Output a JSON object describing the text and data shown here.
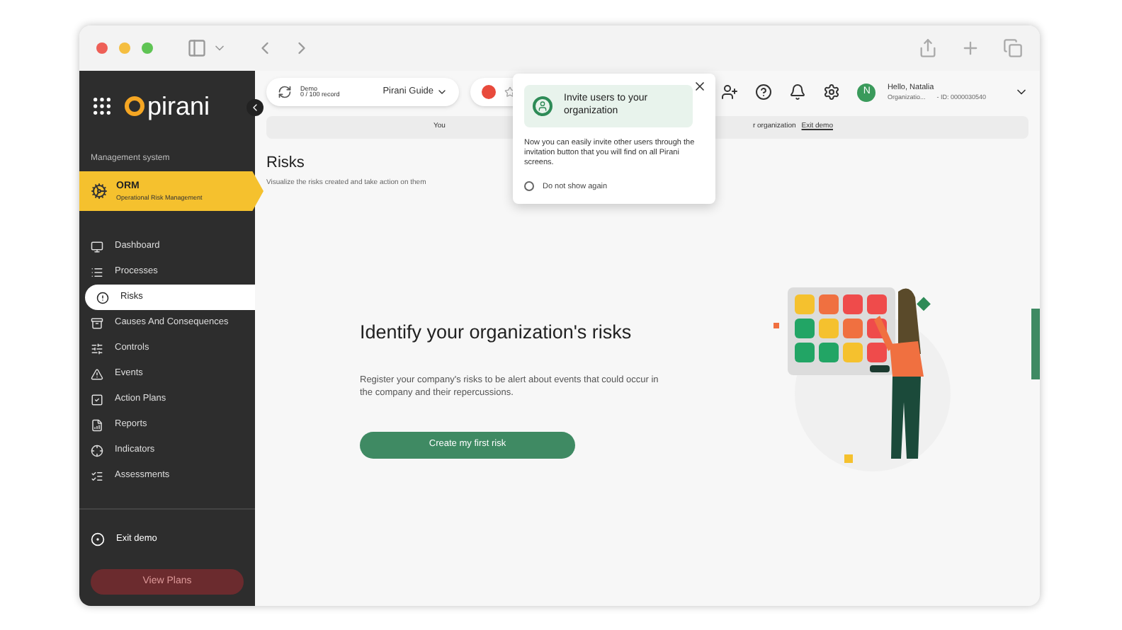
{
  "topbar": {
    "plan_title": "Demo",
    "plan_usage": "0 / 100 record",
    "guide": "Pirani Guide",
    "user_greeting": "Hello, Natalia",
    "organization": "Organizatio...",
    "org_id": "- ID: 0000030540",
    "avatar_initial": "N"
  },
  "banner": {
    "text_start": "You",
    "text_end": "r organization",
    "link": "Exit demo"
  },
  "popover": {
    "title": "Invite users to your organization",
    "body": "Now you can easily invite other users through the invitation button that you will find on all Pirani screens.",
    "checkbox": {
      "label": "Do not show again",
      "checked": false
    }
  },
  "sidebar": {
    "section": "Management system",
    "module": {
      "title": "ORM",
      "subtitle": "Operational Risk Management"
    },
    "logo": "pirani",
    "items": [
      {
        "label": "Dashboard",
        "selected": false
      },
      {
        "label": "Processes",
        "selected": false
      },
      {
        "label": "Risks",
        "selected": true
      },
      {
        "label": "Causes And Consequences",
        "selected": false
      },
      {
        "label": "Controls",
        "selected": false
      },
      {
        "label": "Events",
        "selected": false
      },
      {
        "label": "Action Plans",
        "selected": false
      },
      {
        "label": "Reports",
        "selected": false
      },
      {
        "label": "Indicators",
        "selected": false
      },
      {
        "label": "Assessments",
        "selected": false
      }
    ],
    "exit": "Exit demo",
    "plans_button": "View Plans"
  },
  "page": {
    "title": "Risks",
    "subtitle": "Visualize the risks created and take action on them"
  },
  "empty_state": {
    "heading": "Identify your organization's risks",
    "text": "Register your company's risks to be alert about events that could occur in the company and their repercussions.",
    "button": "Create my first risk"
  }
}
